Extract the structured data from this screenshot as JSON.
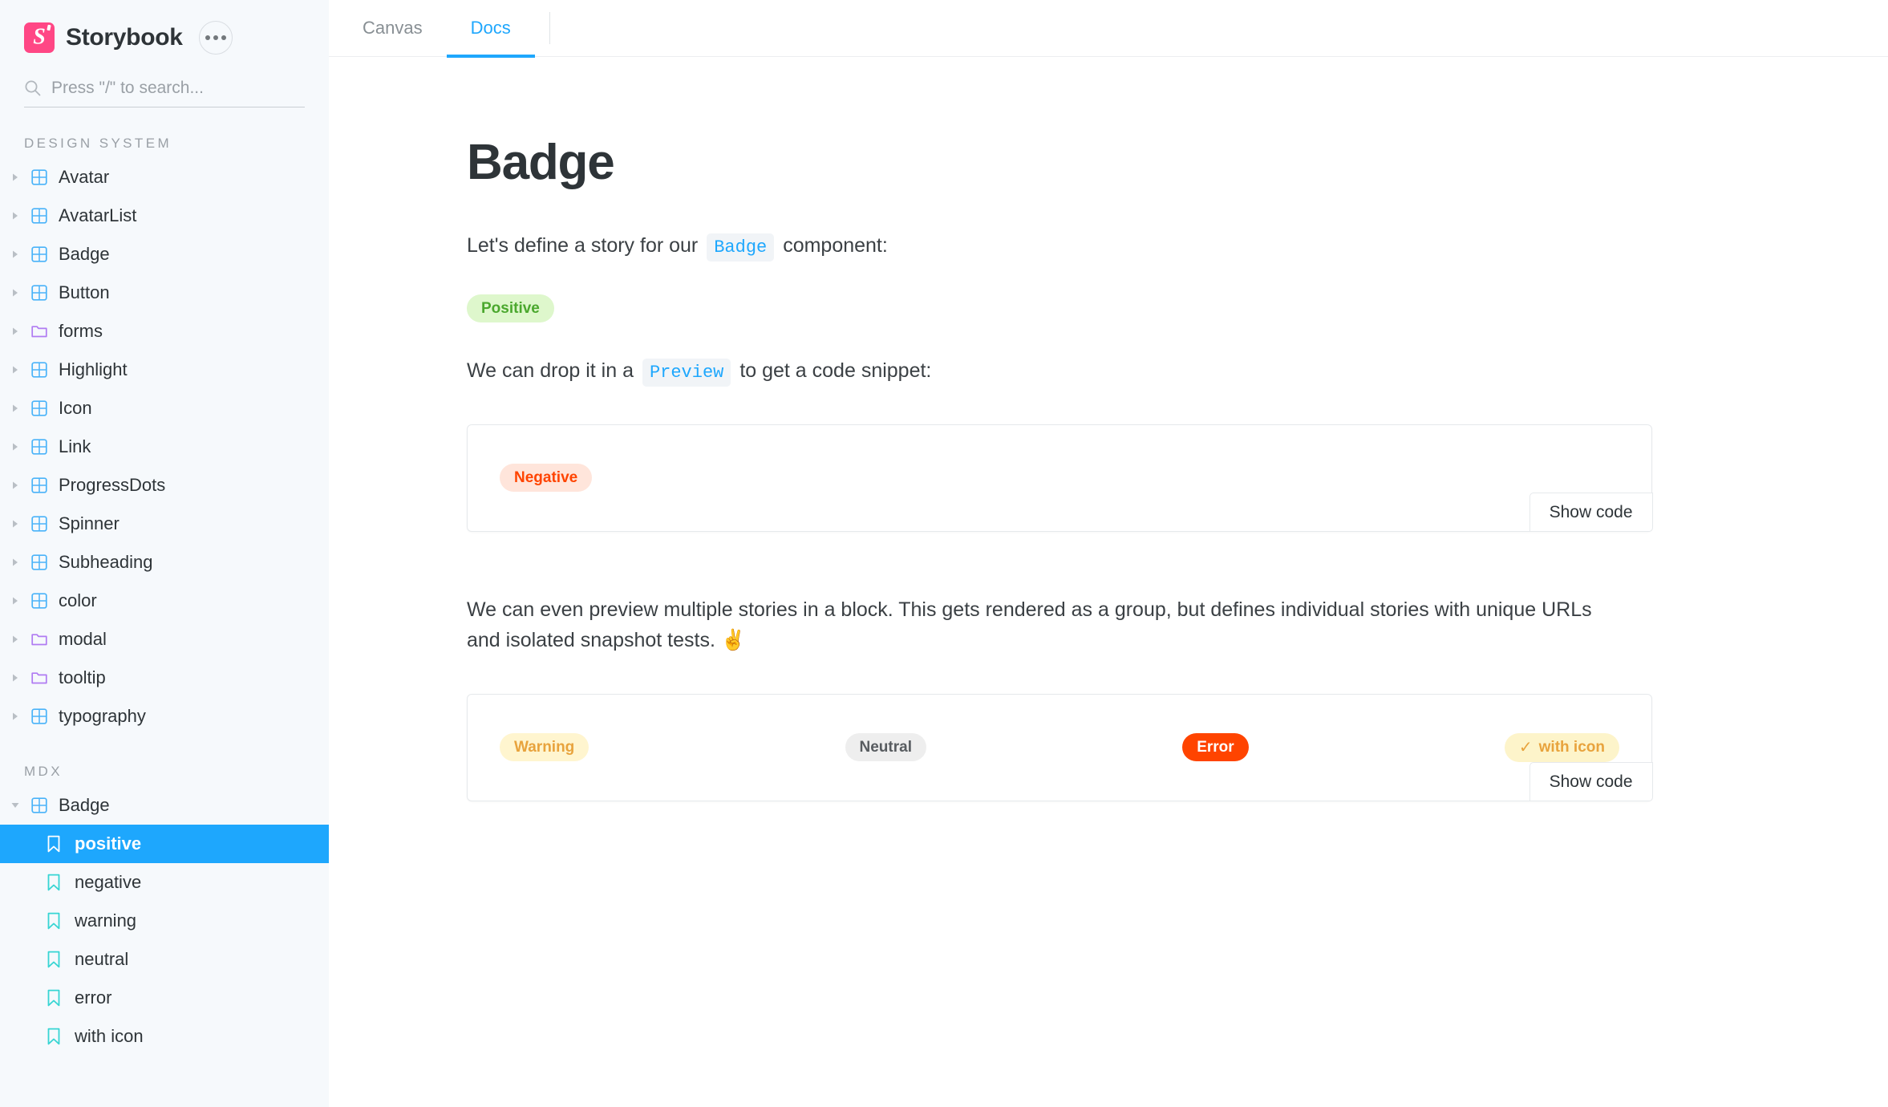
{
  "brand": {
    "name": "Storybook",
    "logo_color": "#ff4785",
    "menu_icon": "ellipsis-icon"
  },
  "search": {
    "placeholder": "Press \"/\" to search...",
    "value": "",
    "icon": "search-icon"
  },
  "sidebar": {
    "accent_selected": "#1ea7fd",
    "background": "#f6f9fc",
    "groups": [
      {
        "label": "DESIGN SYSTEM",
        "items": [
          {
            "label": "Avatar",
            "icon": "component-grid-icon",
            "kind": "component",
            "expanded": false
          },
          {
            "label": "AvatarList",
            "icon": "component-grid-icon",
            "kind": "component",
            "expanded": false
          },
          {
            "label": "Badge",
            "icon": "component-grid-icon",
            "kind": "component",
            "expanded": false
          },
          {
            "label": "Button",
            "icon": "component-grid-icon",
            "kind": "component",
            "expanded": false
          },
          {
            "label": "forms",
            "icon": "folder-icon",
            "kind": "folder",
            "expanded": false
          },
          {
            "label": "Highlight",
            "icon": "component-grid-icon",
            "kind": "component",
            "expanded": false
          },
          {
            "label": "Icon",
            "icon": "component-grid-icon",
            "kind": "component",
            "expanded": false
          },
          {
            "label": "Link",
            "icon": "component-grid-icon",
            "kind": "component",
            "expanded": false
          },
          {
            "label": "ProgressDots",
            "icon": "component-grid-icon",
            "kind": "component",
            "expanded": false
          },
          {
            "label": "Spinner",
            "icon": "component-grid-icon",
            "kind": "component",
            "expanded": false
          },
          {
            "label": "Subheading",
            "icon": "component-grid-icon",
            "kind": "component",
            "expanded": false
          },
          {
            "label": "color",
            "icon": "component-grid-icon",
            "kind": "component",
            "expanded": false
          },
          {
            "label": "modal",
            "icon": "folder-icon",
            "kind": "folder",
            "expanded": false
          },
          {
            "label": "tooltip",
            "icon": "folder-icon",
            "kind": "folder",
            "expanded": false
          },
          {
            "label": "typography",
            "icon": "component-grid-icon",
            "kind": "component",
            "expanded": false
          }
        ]
      },
      {
        "label": "MDX",
        "items": [
          {
            "label": "Badge",
            "icon": "component-grid-icon",
            "kind": "component",
            "expanded": true
          },
          {
            "label": "positive",
            "icon": "bookmark-icon",
            "kind": "story",
            "selected": true
          },
          {
            "label": "negative",
            "icon": "bookmark-icon",
            "kind": "story",
            "selected": false
          },
          {
            "label": "warning",
            "icon": "bookmark-icon",
            "kind": "story",
            "selected": false
          },
          {
            "label": "neutral",
            "icon": "bookmark-icon",
            "kind": "story",
            "selected": false
          },
          {
            "label": "error",
            "icon": "bookmark-icon",
            "kind": "story",
            "selected": false
          },
          {
            "label": "with icon",
            "icon": "bookmark-icon",
            "kind": "story",
            "selected": false
          }
        ]
      }
    ]
  },
  "tabs": [
    {
      "label": "Canvas",
      "active": false
    },
    {
      "label": "Docs",
      "active": true
    }
  ],
  "doc": {
    "title": "Badge",
    "intro": {
      "before": "Let's define a story for our",
      "code": "Badge",
      "after": "component:"
    },
    "positive_badge": {
      "label": "Positive",
      "bg": "#def7cc",
      "fg": "#4ba82e"
    },
    "preview_intro": {
      "before": "We can drop it in a",
      "code": "Preview",
      "after": "to get a code snippet:"
    },
    "preview_one": {
      "badge": {
        "label": "Negative",
        "bg": "#ffe5db",
        "fg": "#ff4400"
      },
      "show_code_label": "Show code"
    },
    "multi_para": {
      "line1": "We can even preview multiple stories in a block. This gets rendered as a group, but defines individual stories with unique URLs",
      "line2": "and isolated snapshot tests.",
      "emoji": "✌️"
    },
    "preview_two": {
      "badges": [
        {
          "label": "Warning",
          "bg": "#fff5cf",
          "fg": "#e8a33d",
          "icon": null
        },
        {
          "label": "Neutral",
          "bg": "#eeeeee",
          "fg": "#585c60",
          "icon": null
        },
        {
          "label": "Error",
          "bg": "#ff4400",
          "fg": "#ffffff",
          "icon": null
        },
        {
          "label": "with icon",
          "bg": "#fdf4ca",
          "fg": "#e8a33d",
          "icon": "check-icon"
        }
      ],
      "show_code_label": "Show code"
    }
  }
}
